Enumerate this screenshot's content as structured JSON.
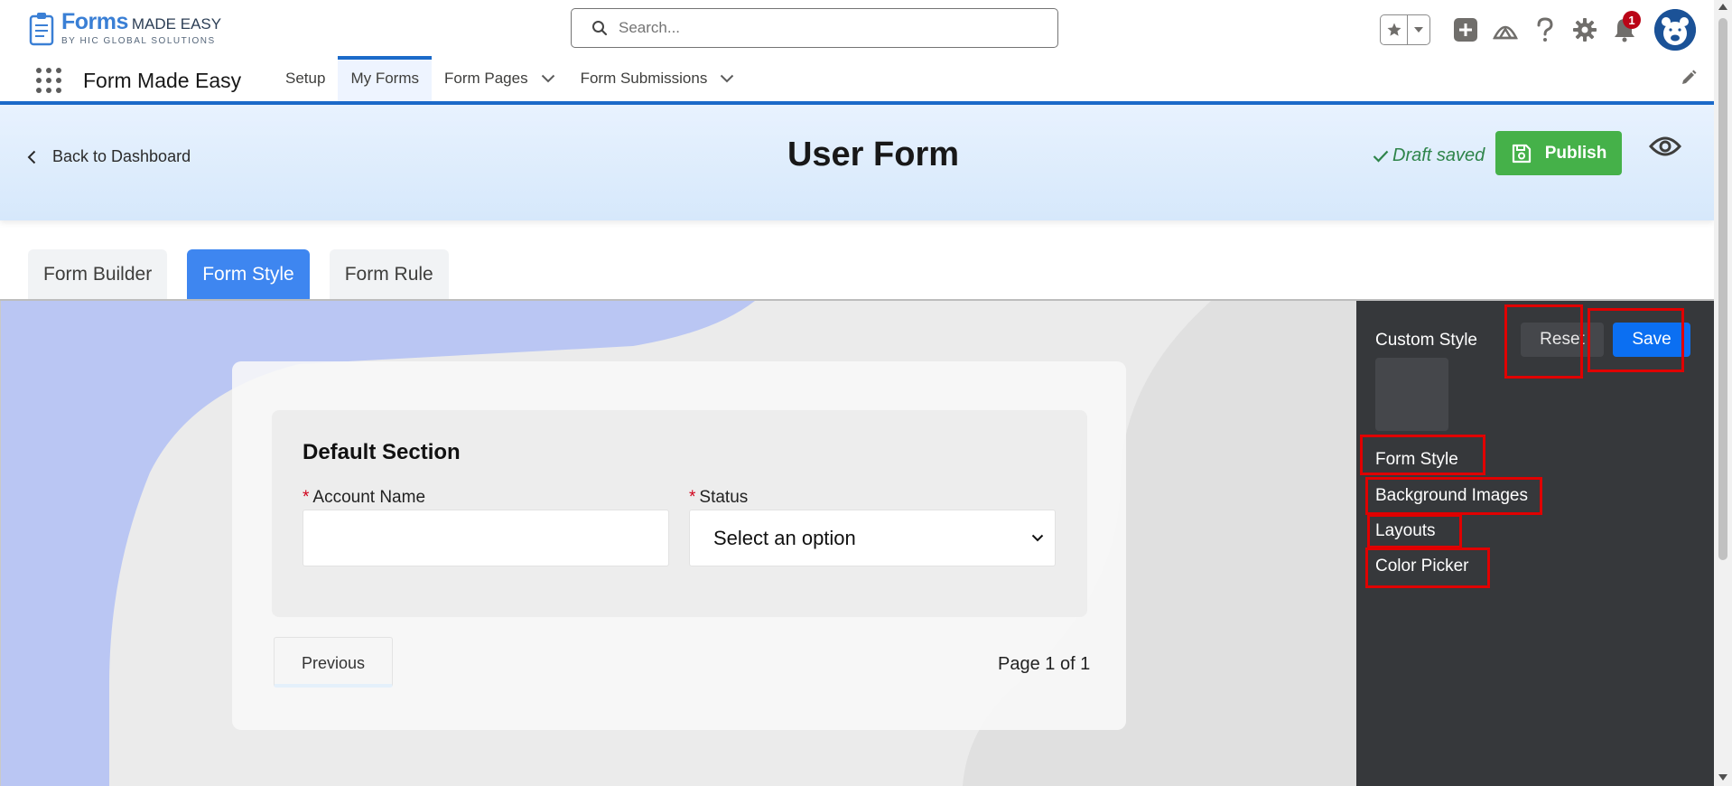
{
  "brand": {
    "logo_forms": "Forms",
    "logo_made_easy": "MADE EASY",
    "logo_sub": "BY HIC GLOBAL SOLUTIONS"
  },
  "header": {
    "search_placeholder": "Search...",
    "notification_count": "1",
    "icons": [
      "favorites-star-icon",
      "favorites-dropdown-icon",
      "global-add-icon",
      "trailhead-icon",
      "help-icon",
      "setup-gear-icon",
      "notification-bell-icon",
      "avatar"
    ]
  },
  "app_nav": {
    "app_name": "Form Made Easy",
    "items": [
      {
        "label": "Setup",
        "has_dropdown": false,
        "active": false
      },
      {
        "label": "My Forms",
        "has_dropdown": false,
        "active": true
      },
      {
        "label": "Form Pages",
        "has_dropdown": true,
        "active": false
      },
      {
        "label": "Form Submissions",
        "has_dropdown": true,
        "active": false
      }
    ]
  },
  "page_header": {
    "back_label": "Back to Dashboard",
    "title": "User Form",
    "draft_status": "Draft saved",
    "publish_label": "Publish"
  },
  "tabs": [
    {
      "label": "Form Builder",
      "active": false
    },
    {
      "label": "Form Style",
      "active": true
    },
    {
      "label": "Form Rule",
      "active": false
    }
  ],
  "form": {
    "section_title": "Default Section",
    "fields": [
      {
        "label": "Account Name",
        "required": true,
        "type": "text",
        "value": ""
      },
      {
        "label": "Status",
        "required": true,
        "type": "select",
        "value": "Select an option"
      }
    ],
    "previous_label": "Previous",
    "page_indicator": "Page 1 of 1"
  },
  "style_panel": {
    "title": "Custom Style",
    "reset_label": "Reset",
    "save_label": "Save",
    "items": [
      "Form Style",
      "Background Images",
      "Layouts",
      "Color Picker"
    ]
  },
  "colors": {
    "accent": "#1b6ac9",
    "tab_active": "#3e86f0",
    "publish": "#45b149",
    "save": "#0b6ff2",
    "panel_bg": "#36383b",
    "highlight": "#e00000",
    "draft_saved": "#2e844a"
  }
}
